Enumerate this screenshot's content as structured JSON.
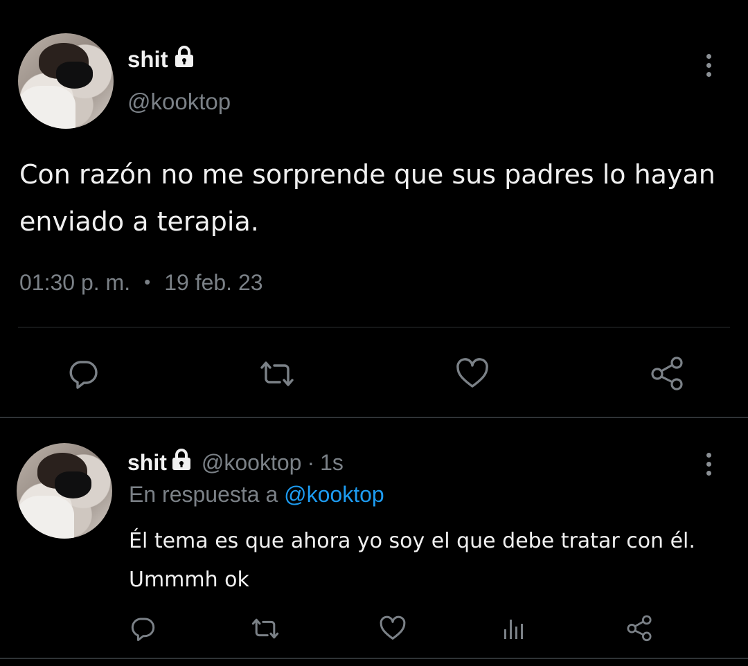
{
  "main_tweet": {
    "display_name": "shit",
    "handle": "@kooktop",
    "text": "Con razón no me sorprende que sus padres lo hayan enviado a terapia.",
    "time": "01:30 p. m.",
    "separator": "•",
    "date": "19 feb. 23",
    "actions": [
      "reply-icon",
      "retweet-icon",
      "like-icon",
      "share-icon"
    ]
  },
  "reply_tweet": {
    "display_name": "shit",
    "handle": "@kooktop",
    "dot": "·",
    "time": "1s",
    "replying_prefix": "En respuesta a",
    "replying_to": "@kooktop",
    "text_line1": "Él tema es que ahora yo soy el que debe tratar con él.",
    "text_line2": "Ummmh ok",
    "actions": [
      "reply-icon",
      "retweet-icon",
      "like-icon",
      "analytics-icon",
      "share-icon"
    ]
  },
  "colors": {
    "background": "#000000",
    "text_primary": "#e7e9ea",
    "text_secondary": "#7b8187",
    "link": "#1d9bf0",
    "divider": "#2f3336"
  }
}
